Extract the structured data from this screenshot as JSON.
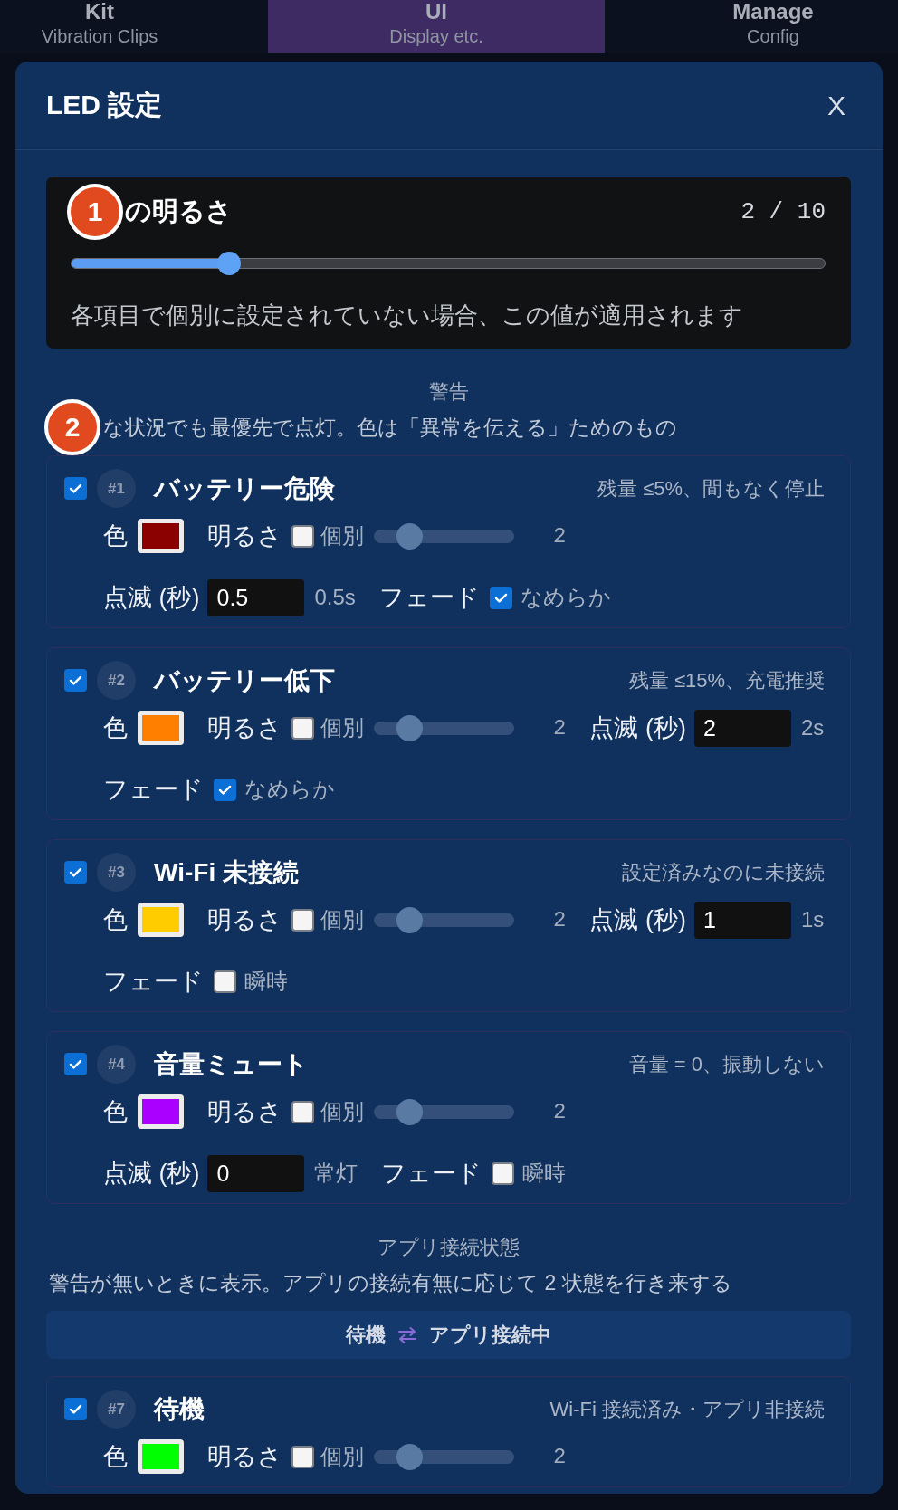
{
  "tabs": [
    {
      "title": "Kit",
      "subtitle": "Vibration Clips",
      "selected": false
    },
    {
      "title": "UI",
      "subtitle": "Display etc.",
      "selected": true
    },
    {
      "title": "Manage",
      "subtitle": "Config",
      "selected": false
    }
  ],
  "dialog": {
    "title": "LED 設定",
    "close": "X"
  },
  "global_brightness": {
    "marker": "1",
    "title": "の明るさ",
    "value": "2 / 10",
    "level": 0.2,
    "note": "各項目で個別に設定されていない場合、この値が適用されます"
  },
  "sections": [
    {
      "title": "警告",
      "marker": "2",
      "description": "な状況でも最優先で点灯。色は「異常を伝える」ためのもの",
      "items": [
        {
          "enabled": true,
          "number": "#1",
          "name": "バッテリー危険",
          "condition": "残量 ≤5%、間もなく停止",
          "color_label": "色",
          "color": "#8b0000",
          "brightness_label": "明るさ",
          "individual": false,
          "individual_label": "個別",
          "level": 0.2,
          "value": "2",
          "blink_label": "点滅 (秒)",
          "blink": "0.5",
          "blink_hint": "0.5s",
          "fade_label": "フェード",
          "fade": true,
          "fade_text": "なめらか"
        },
        {
          "enabled": true,
          "number": "#2",
          "name": "バッテリー低下",
          "condition": "残量 ≤15%、充電推奨",
          "color_label": "色",
          "color": "#ff8000",
          "brightness_label": "明るさ",
          "individual": false,
          "individual_label": "個別",
          "level": 0.2,
          "value": "2",
          "blink_label": "点滅 (秒)",
          "blink": "2",
          "blink_hint": "2s",
          "fade_label": "フェード",
          "fade": true,
          "fade_text": "なめらか"
        },
        {
          "enabled": true,
          "number": "#3",
          "name": "Wi-Fi 未接続",
          "condition": "設定済みなのに未接続",
          "color_label": "色",
          "color": "#ffcc00",
          "brightness_label": "明るさ",
          "individual": false,
          "individual_label": "個別",
          "level": 0.2,
          "value": "2",
          "blink_label": "点滅 (秒)",
          "blink": "1",
          "blink_hint": "1s",
          "fade_label": "フェード",
          "fade": false,
          "fade_text": "瞬時"
        },
        {
          "enabled": true,
          "number": "#4",
          "name": "音量ミュート",
          "condition": "音量 = 0、振動しない",
          "color_label": "色",
          "color": "#aa00ff",
          "brightness_label": "明るさ",
          "individual": false,
          "individual_label": "個別",
          "level": 0.2,
          "value": "2",
          "blink_label": "点滅 (秒)",
          "blink": "0",
          "blink_hint": "常灯",
          "fade_label": "フェード",
          "fade": false,
          "fade_text": "瞬時"
        }
      ]
    },
    {
      "title": "アプリ接続状態",
      "description": "警告が無いときに表示。アプリの接続有無に応じて 2 状態を行き来する",
      "flow": {
        "states": [
          "待機",
          "アプリ接続中"
        ]
      },
      "items": [
        {
          "enabled": true,
          "number": "#7",
          "name": "待機",
          "condition": "Wi-Fi 接続済み・アプリ非接続",
          "color_label": "色",
          "color": "#00ff00",
          "brightness_label": "明るさ",
          "individual": false,
          "individual_label": "個別",
          "level": 0.2,
          "value": "2"
        }
      ]
    }
  ]
}
